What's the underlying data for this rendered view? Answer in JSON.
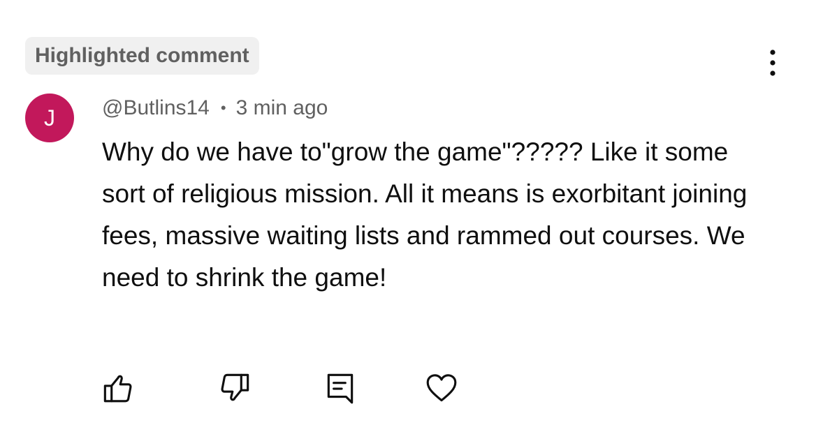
{
  "badge": {
    "label": "Highlighted comment"
  },
  "comment": {
    "avatar_initial": "J",
    "avatar_color": "#c2185b",
    "author": "@Butlins14",
    "separator": "•",
    "timestamp": "3 min ago",
    "text": "Why do we have to\"grow the game\"????? Like it some sort of religious mission.  All it means is exorbitant joining fees, massive waiting lists and rammed out courses.  We need to shrink the game!"
  },
  "actions": [
    {
      "name": "like",
      "icon": "thumbs-up-icon"
    },
    {
      "name": "dislike",
      "icon": "thumbs-down-icon"
    },
    {
      "name": "reply",
      "icon": "reply-comment-icon"
    },
    {
      "name": "heart",
      "icon": "heart-icon"
    }
  ],
  "menu": {
    "icon": "more-vertical-icon"
  },
  "colors": {
    "text_primary": "#0f0f0f",
    "text_secondary": "#606060",
    "badge_background": "#f0f0f0"
  }
}
